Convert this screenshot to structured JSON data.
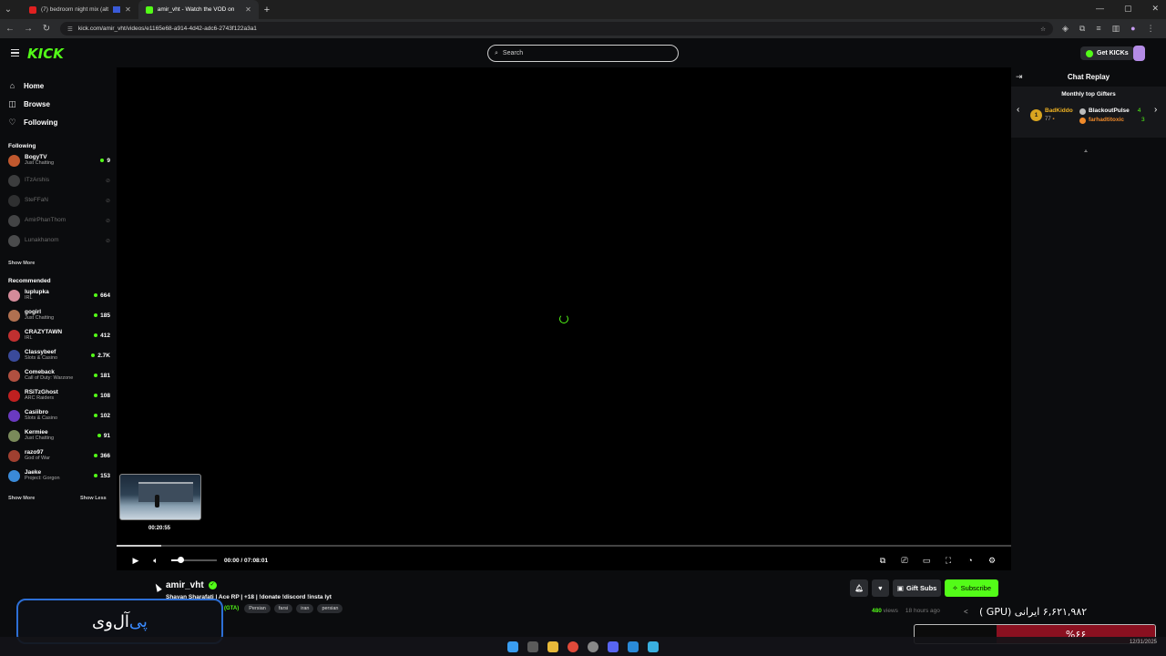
{
  "browser": {
    "tabs": [
      {
        "title": "(7) bedroom night mix (alt",
        "active": false
      },
      {
        "title": "amir_vht - Watch the VOD on",
        "active": true
      }
    ],
    "url": "kick.com/amir_vht/videos/e1165e68-a914-4d42-adc6-2743f122a3a1"
  },
  "header": {
    "logo": "KICK",
    "search_placeholder": "Search",
    "get_kicks": "Get KICKs"
  },
  "sidebar": {
    "nav": [
      {
        "label": "Home",
        "icon": "home-icon"
      },
      {
        "label": "Browse",
        "icon": "compass-icon"
      },
      {
        "label": "Following",
        "icon": "heart-icon"
      }
    ],
    "following_title": "Following",
    "following": [
      {
        "name": "BogyTV",
        "category": "Just Chatting",
        "viewers": "9",
        "live": true,
        "color": "#c0582e"
      },
      {
        "name": "ITzArshis",
        "category": "",
        "viewers": "",
        "live": false,
        "color": "#888"
      },
      {
        "name": "SteFFaN",
        "category": "",
        "viewers": "",
        "live": false,
        "color": "#666"
      },
      {
        "name": "AmirPhanThom",
        "category": "",
        "viewers": "",
        "live": false,
        "color": "#999"
      },
      {
        "name": "Lunakhanom",
        "category": "",
        "viewers": "",
        "live": false,
        "color": "#aaa"
      }
    ],
    "show_more_1": "Show More",
    "recommended_title": "Recommended",
    "recommended": [
      {
        "name": "luplupka",
        "category": "IRL",
        "viewers": "664",
        "color": "#d48b9a"
      },
      {
        "name": "gogirl",
        "category": "Just Chatting",
        "viewers": "185",
        "color": "#b07050"
      },
      {
        "name": "CRAZYTAWN",
        "category": "IRL",
        "viewers": "412",
        "color": "#c03030"
      },
      {
        "name": "Classybeef",
        "category": "Slots & Casino",
        "viewers": "2.7K",
        "color": "#3a4a9a"
      },
      {
        "name": "Comeback",
        "category": "Call of Duty: Warzone",
        "viewers": "181",
        "color": "#b05040"
      },
      {
        "name": "RSiTzGhost",
        "category": "ARC Raiders",
        "viewers": "108",
        "color": "#c02020"
      },
      {
        "name": "Casiibro",
        "category": "Slots & Casino",
        "viewers": "102",
        "color": "#6a3ac0"
      },
      {
        "name": "Kermiee",
        "category": "Just Chatting",
        "viewers": "91",
        "color": "#7a8a5a"
      },
      {
        "name": "razo97",
        "category": "God of War",
        "viewers": "366",
        "color": "#a04030"
      },
      {
        "name": "Jaeke",
        "category": "Project: Gorgon",
        "viewers": "153",
        "color": "#3a8ad8"
      }
    ],
    "show_more_2": "Show More",
    "show_less": "Show Less"
  },
  "player": {
    "preview_time": "00:20:55",
    "current_time": "00:00",
    "duration": "07:08:01",
    "time_separator": " / ",
    "volume_fraction": 0.2,
    "buffered_fraction": 0.05
  },
  "video": {
    "streamer": "amir_vht",
    "title": "Shayan Sharafati | Ace RP | +18 | !donate !discord !insta lyt",
    "category": "(GTA)",
    "tags": [
      "Persian",
      "farsi",
      "iran",
      "persian"
    ],
    "gift_subs": "Gift Subs",
    "subscribe": "Subscribe",
    "views_count": "480",
    "views_label": " views",
    "ago": "18 hours ago"
  },
  "chat": {
    "title": "Chat Replay",
    "gifters_title": "Monthly top Gifters",
    "gifters": [
      {
        "rank": "1",
        "name": "BadKiddo",
        "count": "77"
      },
      {
        "name": "BlackoutPulse",
        "count": "4"
      },
      {
        "name": "farhadtitoxic",
        "count": "3"
      }
    ]
  },
  "overlay": {
    "brand_a": "آل‌وی",
    "brand_b": "پی",
    "gpu_text": "۶,۶۲۱,۹۸۲ ایرانی (GPU )",
    "percent_text": "%۶۶",
    "percent_value": 0.66
  },
  "system": {
    "time": "",
    "date": "12/31/2025"
  }
}
